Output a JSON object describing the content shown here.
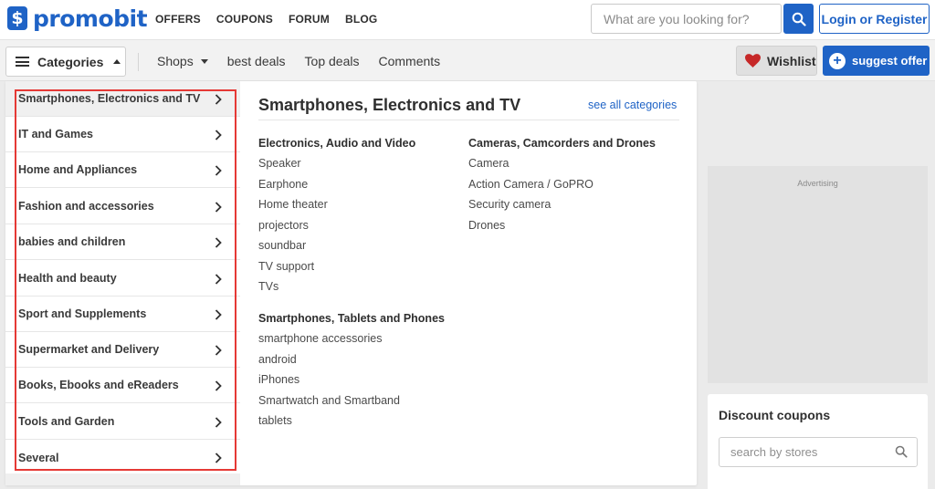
{
  "header": {
    "logo_mark": "$",
    "logo_text": "promobit",
    "nav": [
      "OFFERS",
      "COUPONS",
      "FORUM",
      "BLOG"
    ],
    "search_placeholder": "What are you looking for?",
    "login_label": "Login or Register"
  },
  "subnav": {
    "categories_label": "Categories",
    "shops_label": "Shops",
    "best_deals_label": "best deals",
    "top_deals_label": "Top deals",
    "comments_label": "Comments",
    "wishlist_label": "Wishlist",
    "suggest_label": "suggest offer"
  },
  "sidebar": {
    "advertising_label": "Advertising",
    "coupons_title": "Discount coupons",
    "coupons_placeholder": "search by stores"
  },
  "menu": {
    "categories": [
      "Smartphones, Electronics and TV",
      "IT and Games",
      "Home and Appliances",
      "Fashion and accessories",
      "babies and children",
      "Health and beauty",
      "Sport and Supplements",
      "Supermarket and Delivery",
      "Books, Ebooks and eReaders",
      "Tools and Garden",
      "Several"
    ],
    "panel_title": "Smartphones, Electronics and TV",
    "see_all_label": "see all categories",
    "groups": [
      {
        "title": "Electronics, Audio and Video",
        "items": [
          "Speaker",
          "Earphone",
          "Home theater",
          "projectors",
          "soundbar",
          "TV support",
          "TVs"
        ]
      },
      {
        "title": "Smartphones, Tablets and Phones",
        "items": [
          "smartphone accessories",
          "android",
          "iPhones",
          "Smartwatch and Smartband",
          "tablets"
        ]
      },
      {
        "title": "Cameras, Camcorders and Drones",
        "items": [
          "Camera",
          "Action Camera / GoPRO",
          "Security camera",
          "Drones"
        ]
      }
    ]
  },
  "colors": {
    "brand": "#1f63c6",
    "highlight": "#e53935",
    "wishlist_heart": "#c62828"
  }
}
